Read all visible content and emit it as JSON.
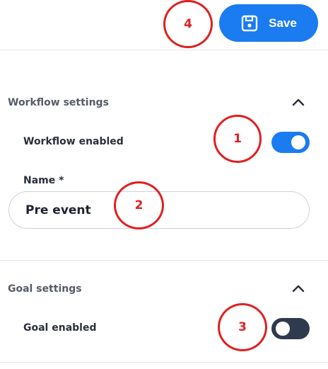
{
  "toolbar": {
    "save_label": "Save"
  },
  "workflow_settings": {
    "title": "Workflow settings",
    "enabled_label": "Workflow enabled",
    "enabled": true,
    "name_label": "Name *",
    "name_value": "Pre event"
  },
  "goal_settings": {
    "title": "Goal settings",
    "enabled_label": "Goal enabled",
    "enabled": false
  },
  "annotations": {
    "marker_1": "1",
    "marker_2": "2",
    "marker_3": "3",
    "marker_4": "4"
  },
  "colors": {
    "accent": "#1a7cf0",
    "toggle_off": "#2f3a4e",
    "annotation": "#e02020"
  }
}
